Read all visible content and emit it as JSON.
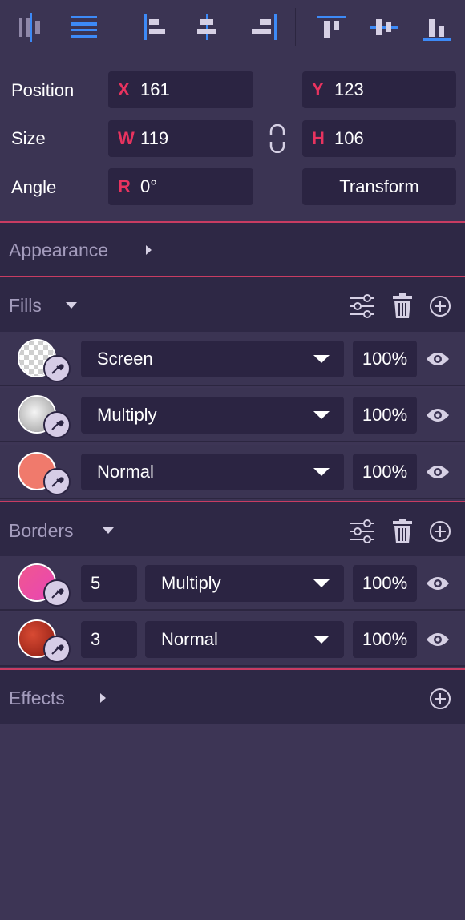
{
  "toolbar": {
    "buttons": [
      {
        "name": "distribute-horizontal-icon"
      },
      {
        "name": "distribute-vertical-icon"
      },
      {
        "name": "align-left-icon"
      },
      {
        "name": "align-center-horizontal-icon"
      },
      {
        "name": "align-right-icon"
      },
      {
        "name": "align-top-icon"
      },
      {
        "name": "align-middle-vertical-icon"
      },
      {
        "name": "align-bottom-icon"
      }
    ]
  },
  "properties": {
    "position_label": "Position",
    "size_label": "Size",
    "angle_label": "Angle",
    "x_prefix": "X",
    "x_value": "161",
    "y_prefix": "Y",
    "y_value": "123",
    "w_prefix": "W",
    "w_value": "119",
    "h_prefix": "H",
    "h_value": "106",
    "r_prefix": "R",
    "r_value": "0°",
    "transform_label": "Transform"
  },
  "appearance": {
    "title": "Appearance"
  },
  "fills": {
    "title": "Fills",
    "items": [
      {
        "blend": "Screen",
        "opacity": "100%",
        "swatch": "transparent-checker"
      },
      {
        "blend": "Multiply",
        "opacity": "100%",
        "swatch": "#d9d9d9"
      },
      {
        "blend": "Normal",
        "opacity": "100%",
        "swatch": "#f07a6c"
      }
    ]
  },
  "borders": {
    "title": "Borders",
    "items": [
      {
        "width": "5",
        "blend": "Multiply",
        "opacity": "100%",
        "swatch": "#f0578f"
      },
      {
        "width": "3",
        "blend": "Normal",
        "opacity": "100%",
        "swatch": "#c1301f"
      }
    ]
  },
  "effects": {
    "title": "Effects"
  },
  "colors": {
    "accent": "#c83c62",
    "prefix": "#e8335f",
    "panel": "#3b3453",
    "field": "#2b2442",
    "section_header": "#2e2845",
    "icon_blue": "#3d8af7"
  }
}
